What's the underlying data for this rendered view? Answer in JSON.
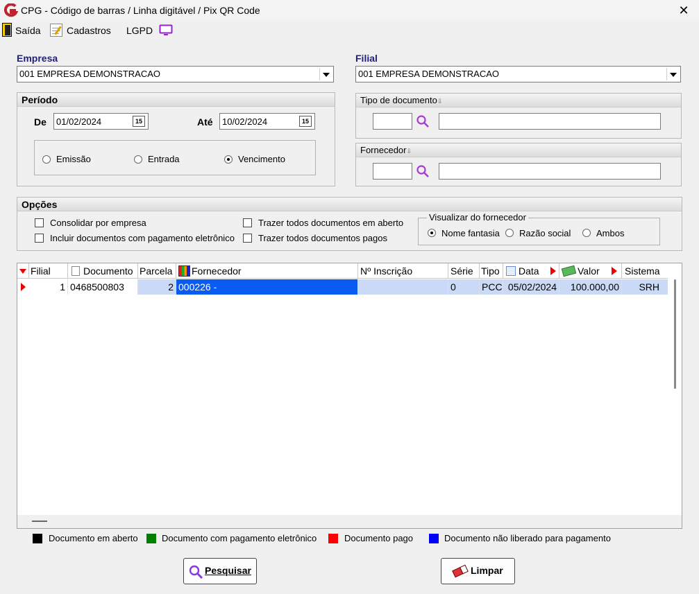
{
  "window": {
    "title": "CPG - Código de barras / Linha digitável / Pix QR Code",
    "close_symbol": "✕"
  },
  "menu": {
    "saida": "Saída",
    "cadastros": "Cadastros",
    "lgpd": "LGPD"
  },
  "empresa": {
    "label": "Empresa",
    "value": "001 EMPRESA DEMONSTRACAO"
  },
  "filial": {
    "label": "Filial",
    "value": "001 EMPRESA DEMONSTRACAO"
  },
  "periodo": {
    "label": "Período",
    "de_label": "De",
    "de_value": "01/02/2024",
    "ate_label": "Até",
    "ate_value": "10/02/2024",
    "cal_glyph": "15",
    "radios": [
      {
        "label": "Emissão",
        "checked": false
      },
      {
        "label": "Entrada",
        "checked": false
      },
      {
        "label": "Vencimento",
        "checked": true
      }
    ]
  },
  "tipo_documento": {
    "label": "Tipo de documento",
    "code": "",
    "desc": ""
  },
  "fornecedor_filter": {
    "label": "Fornecedor",
    "code": "",
    "desc": ""
  },
  "opcoes": {
    "label": "Opções",
    "checks": [
      {
        "label": "Consolidar por empresa",
        "checked": false
      },
      {
        "label": "Incluir documentos com pagamento eletrônico",
        "checked": false
      },
      {
        "label": "Trazer todos documentos em aberto",
        "checked": false
      },
      {
        "label": "Trazer todos documentos pagos",
        "checked": false
      }
    ],
    "visualizar": {
      "label": "Visualizar do fornecedor",
      "options": [
        {
          "label": "Nome fantasia",
          "checked": true
        },
        {
          "label": "Razão social",
          "checked": false
        },
        {
          "label": "Ambos",
          "checked": false
        }
      ]
    }
  },
  "grid": {
    "columns": [
      "Filial",
      "Documento",
      "Parcela",
      "Fornecedor",
      "Nº Inscrição",
      "Série",
      "Tipo",
      "Data",
      "Valor",
      "Sistema"
    ],
    "rows": [
      {
        "filial": "1",
        "documento": "0468500803",
        "parcela": "2",
        "fornecedor": "000226 -",
        "inscricao": "",
        "serie": "0",
        "tipo": "PCC",
        "data": "05/02/2024",
        "valor": "100.000,00",
        "sistema": "SRH"
      }
    ]
  },
  "legend": [
    {
      "color": "#000000",
      "label": "Documento em aberto"
    },
    {
      "color": "#008000",
      "label": "Documento com pagamento eletrônico"
    },
    {
      "color": "#ff0000",
      "label": "Documento pago"
    },
    {
      "color": "#0000ff",
      "label": "Documento não liberado para pagamento"
    }
  ],
  "buttons": {
    "pesquisar": "Pesquisar",
    "limpar": "Limpar"
  },
  "colors": {
    "accent": "#1f1f7a",
    "selected_row": "#cad9f5",
    "selected_cell": "#0a5cf0"
  }
}
